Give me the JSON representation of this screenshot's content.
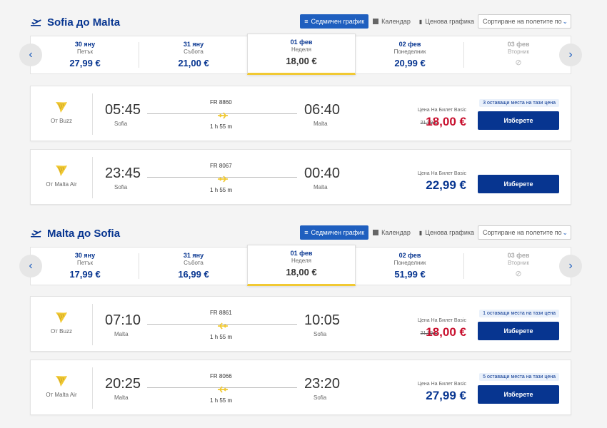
{
  "colors": {
    "brand_blue": "#073590",
    "accent_yellow": "#f1c933",
    "price_red": "#c8102e"
  },
  "sections": [
    {
      "title": "Sofia до Malta",
      "view": {
        "weekly": "Седмичен график",
        "calendar": "Календар",
        "price_chart": "Ценова графика"
      },
      "sort": "Сортиране на полетите по",
      "dates": [
        {
          "date": "30 яну",
          "weekday": "Петък",
          "price": "27,99 €"
        },
        {
          "date": "31 яну",
          "weekday": "Събота",
          "price": "21,00 €"
        },
        {
          "date": "01 фев",
          "weekday": "Неделя",
          "price": "18,00 €",
          "selected": true
        },
        {
          "date": "02 фев",
          "weekday": "Понеделник",
          "price": "20,99 €"
        },
        {
          "date": "03 фев",
          "weekday": "Вторник",
          "price": "⊘",
          "disabled": true
        }
      ],
      "flights": [
        {
          "operator": "От Buzz",
          "dep_time": "05:45",
          "dep_city": "Sofia",
          "flight_no": "FR 8860",
          "duration": "1 h 55 m",
          "arr_time": "06:40",
          "arr_city": "Malta",
          "price_label": "Цена На Билет Basic",
          "old_price": "21,99 €",
          "price": "18,00 €",
          "seats": "3 оставащи места на тази цена",
          "select": "Изберете"
        },
        {
          "operator": "От Malta Air",
          "dep_time": "23:45",
          "dep_city": "Sofia",
          "flight_no": "FR 8067",
          "duration": "1 h 55 m",
          "arr_time": "00:40",
          "arr_city": "Malta",
          "price_label": "Цена На Билет Basic",
          "old_price": "",
          "price": "22,99 €",
          "seats": "",
          "select": "Изберете"
        }
      ]
    },
    {
      "title": "Malta до Sofia",
      "view": {
        "weekly": "Седмичен график",
        "calendar": "Календар",
        "price_chart": "Ценова графика"
      },
      "sort": "Сортиране на полетите по",
      "dates": [
        {
          "date": "30 яну",
          "weekday": "Петък",
          "price": "17,99 €"
        },
        {
          "date": "31 яну",
          "weekday": "Събота",
          "price": "16,99 €"
        },
        {
          "date": "01 фев",
          "weekday": "Неделя",
          "price": "18,00 €",
          "selected": true
        },
        {
          "date": "02 фев",
          "weekday": "Понеделник",
          "price": "51,99 €"
        },
        {
          "date": "03 фев",
          "weekday": "Вторник",
          "price": "⊘",
          "disabled": true
        }
      ],
      "flights": [
        {
          "operator": "От Buzz",
          "dep_time": "07:10",
          "dep_city": "Malta",
          "flight_no": "FR 8861",
          "duration": "1 h 55 m",
          "arr_time": "10:05",
          "arr_city": "Sofia",
          "price_label": "Цена На Билет Basic",
          "old_price": "21,99 €",
          "price": "18,00 €",
          "seats": "1 оставащи места на тази цена",
          "select": "Изберете"
        },
        {
          "operator": "От Malta Air",
          "dep_time": "20:25",
          "dep_city": "Malta",
          "flight_no": "FR 8066",
          "duration": "1 h 55 m",
          "arr_time": "23:20",
          "arr_city": "Sofia",
          "price_label": "Цена На Билет Basic",
          "old_price": "",
          "price": "27,99 €",
          "seats": "5 оставащи места на тази цена",
          "select": "Изберете"
        }
      ]
    }
  ]
}
